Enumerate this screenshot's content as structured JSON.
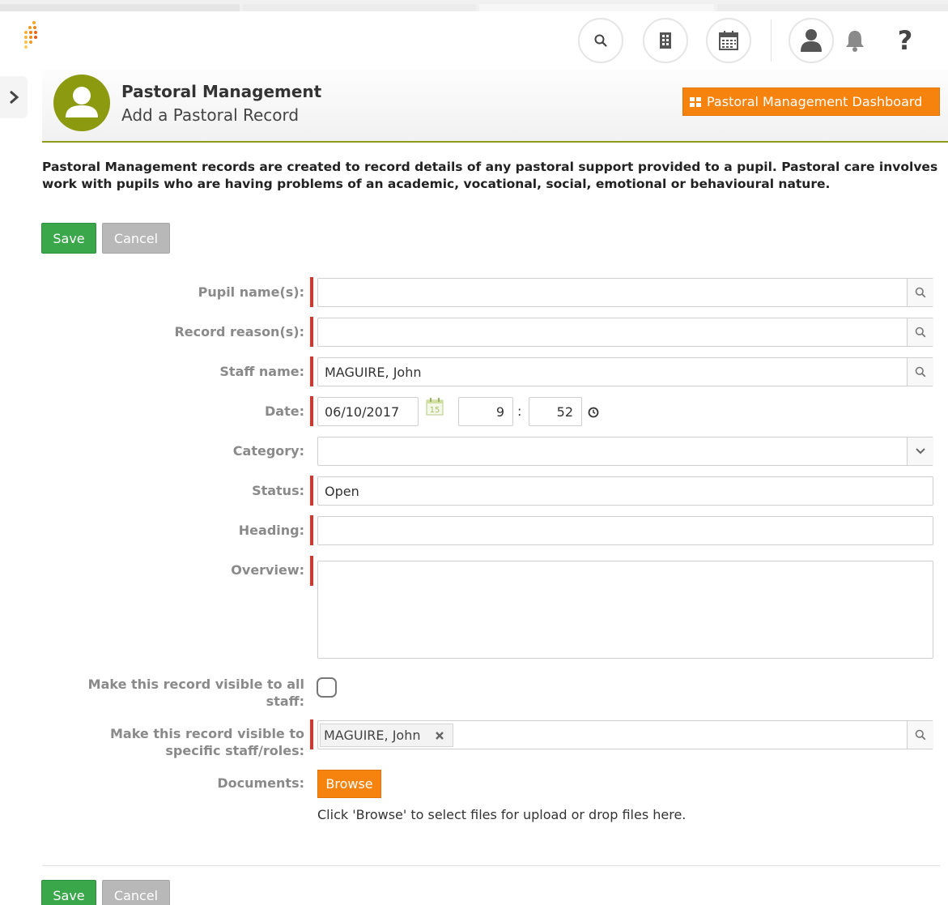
{
  "header": {
    "title": "Pastoral Management",
    "subtitle": "Add a Pastoral Record",
    "dashboard_button": "Pastoral Management Dashboard"
  },
  "top_icons": [
    "search-icon",
    "building-icon",
    "calendar-icon",
    "user-icon",
    "bell-icon",
    "help-icon"
  ],
  "help_glyph": "?",
  "description": "Pastoral Management records are created to record details of any pastoral support provided to a pupil. Pastoral care involves work with pupils who are having problems of an academic, vocational, social, emotional or behavioural nature.",
  "actions": {
    "save": "Save",
    "cancel": "Cancel"
  },
  "form": {
    "pupil_names": {
      "label": "Pupil name(s):",
      "value": ""
    },
    "record_reasons": {
      "label": "Record reason(s):",
      "value": ""
    },
    "staff_name": {
      "label": "Staff name:",
      "value": "MAGUIRE, John"
    },
    "date": {
      "label": "Date:",
      "value": "06/10/2017",
      "calendar_day": "15",
      "hour": "9",
      "separator": ":",
      "minute": "52"
    },
    "category": {
      "label": "Category:",
      "value": ""
    },
    "status": {
      "label": "Status:",
      "value": "Open"
    },
    "heading": {
      "label": "Heading:",
      "value": ""
    },
    "overview": {
      "label": "Overview:",
      "value": ""
    },
    "visible_all": {
      "label_line1": "Make this record visible to all",
      "label_line2": "staff:",
      "checked": false
    },
    "visible_specific": {
      "label_line1": "Make this record visible to",
      "label_line2": "specific staff/roles:",
      "chip": "MAGUIRE, John"
    },
    "documents": {
      "label": "Documents:",
      "browse": "Browse",
      "hint": "Click 'Browse' to select files for upload or drop files here."
    }
  },
  "colors": {
    "accent_orange": "#f7830f",
    "save_green": "#3aa84a",
    "cancel_grey": "#b8b8b8",
    "required_red": "#d9342b",
    "header_olive": "#8c9a10"
  }
}
